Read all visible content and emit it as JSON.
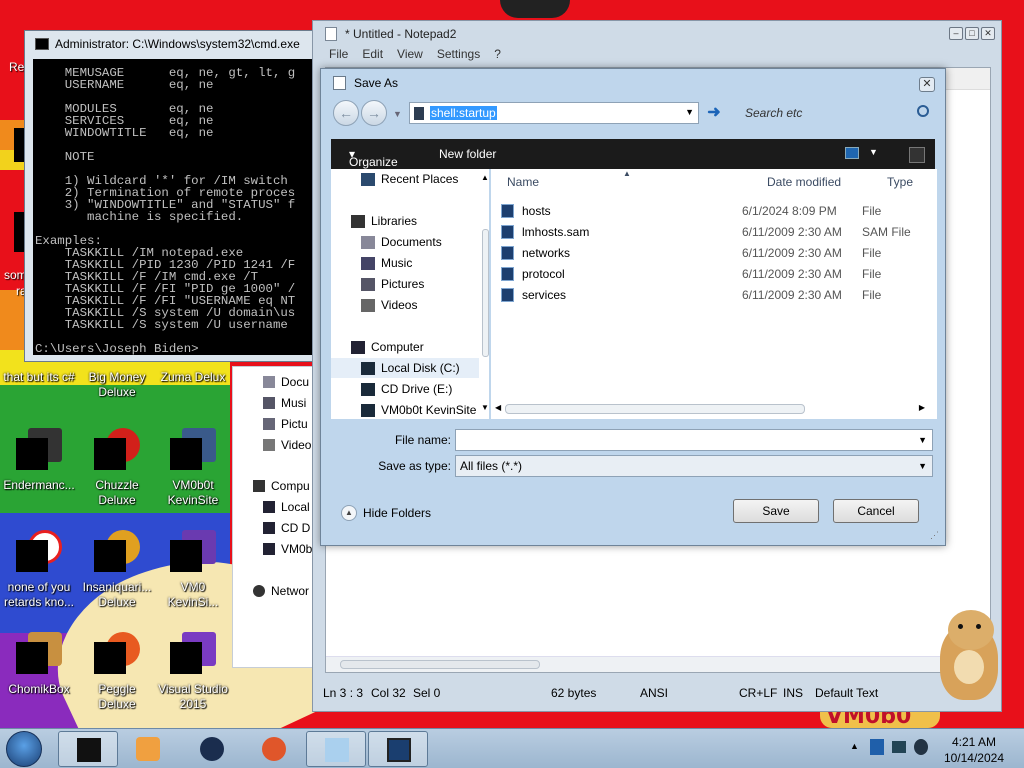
{
  "desktop": {
    "partial_labels": [
      {
        "id": "re",
        "text": "Re"
      },
      {
        "id": "some",
        "text": "som"
      },
      {
        "id": "ra",
        "text": "ra"
      }
    ],
    "icons": [
      {
        "label": "that but its c#"
      },
      {
        "label": "Big Money Deluxe"
      },
      {
        "label": "Zuma Delux"
      },
      {
        "label": "Endermanc..."
      },
      {
        "label": "Chuzzle Deluxe"
      },
      {
        "label": "VM0b0t KevinSite"
      },
      {
        "label": "none of you retards kno..."
      },
      {
        "label": "Insaniquari... Deluxe"
      },
      {
        "label": "VM0 KevinSi..."
      },
      {
        "label": "ChomikBox"
      },
      {
        "label": "Peggle Deluxe"
      },
      {
        "label": "Visual Studio 2015"
      }
    ],
    "watermark": "VM0b0"
  },
  "cmd": {
    "title": "Administrator: C:\\Windows\\system32\\cmd.exe",
    "lines": [
      "    MEMUSAGE      eq, ne, gt, lt, g",
      "    USERNAME      eq, ne",
      "",
      "    MODULES       eq, ne",
      "    SERVICES      eq, ne",
      "    WINDOWTITLE   eq, ne",
      "",
      "    NOTE",
      "",
      "    1) Wildcard '*' for /IM switch",
      "    2) Termination of remote proces",
      "    3) \"WINDOWTITLE\" and \"STATUS\" f",
      "       machine is specified.",
      "",
      "Examples:",
      "    TASKKILL /IM notepad.exe",
      "    TASKKILL /PID 1230 /PID 1241 /F",
      "    TASKKILL /F /IM cmd.exe /T",
      "    TASKKILL /F /FI \"PID ge 1000\" /",
      "    TASKKILL /F /FI \"USERNAME eq NT",
      "    TASKKILL /S system /U domain\\us",
      "    TASKKILL /S system /U username ",
      "",
      "C:\\Users\\Joseph Biden>"
    ]
  },
  "explorer_fragment": {
    "items": [
      "Docu",
      "Musi",
      "Pictu",
      "Video",
      "Compu",
      "Local",
      "CD D",
      "VM0b",
      "Networ"
    ]
  },
  "notepad": {
    "title": "* Untitled - Notepad2",
    "menu": [
      "File",
      "Edit",
      "View",
      "Settings",
      "?"
    ],
    "status": {
      "position": "Ln 3 : 3",
      "col": "Col 32",
      "sel": "Sel 0",
      "bytes": "62 bytes",
      "encoding": "ANSI",
      "eol": "CR+LF",
      "ins": "INS",
      "scheme": "Default Text"
    }
  },
  "save_dialog": {
    "title": "Save As",
    "address": "shell:startup",
    "search_placeholder": "Search etc",
    "toolbar": {
      "organize": "Organize",
      "new_folder": "New folder"
    },
    "nav": [
      {
        "label": "Recent Places",
        "icon": "recent-places-icon",
        "indent": 1
      },
      {
        "label": "Libraries",
        "icon": "libraries-icon",
        "indent": 0
      },
      {
        "label": "Documents",
        "icon": "documents-icon",
        "indent": 1
      },
      {
        "label": "Music",
        "icon": "music-icon",
        "indent": 1
      },
      {
        "label": "Pictures",
        "icon": "pictures-icon",
        "indent": 1
      },
      {
        "label": "Videos",
        "icon": "videos-icon",
        "indent": 1
      },
      {
        "label": "Computer",
        "icon": "computer-icon",
        "indent": 0
      },
      {
        "label": "Local Disk (C:)",
        "icon": "local-disk-icon",
        "indent": 1
      },
      {
        "label": "CD Drive (E:)",
        "icon": "cd-drive-icon",
        "indent": 1
      },
      {
        "label": "VM0b0t KevinSite",
        "icon": "network-drive-icon",
        "indent": 1
      }
    ],
    "columns": {
      "name": "Name",
      "date": "Date modified",
      "type": "Type"
    },
    "files": [
      {
        "name": "hosts",
        "date": "6/1/2024 8:09 PM",
        "type": "File"
      },
      {
        "name": "lmhosts.sam",
        "date": "6/11/2009 2:30 AM",
        "type": "SAM File"
      },
      {
        "name": "networks",
        "date": "6/11/2009 2:30 AM",
        "type": "File"
      },
      {
        "name": "protocol",
        "date": "6/11/2009 2:30 AM",
        "type": "File"
      },
      {
        "name": "services",
        "date": "6/11/2009 2:30 AM",
        "type": "File"
      }
    ],
    "file_name_label": "File name:",
    "file_name_value": "",
    "save_type_label": "Save as type:",
    "save_type_value": "All files (*.*)",
    "hide_folders": "Hide Folders",
    "save": "Save",
    "cancel": "Cancel"
  },
  "taskbar": {
    "time": "4:21 AM",
    "date": "10/14/2024"
  }
}
